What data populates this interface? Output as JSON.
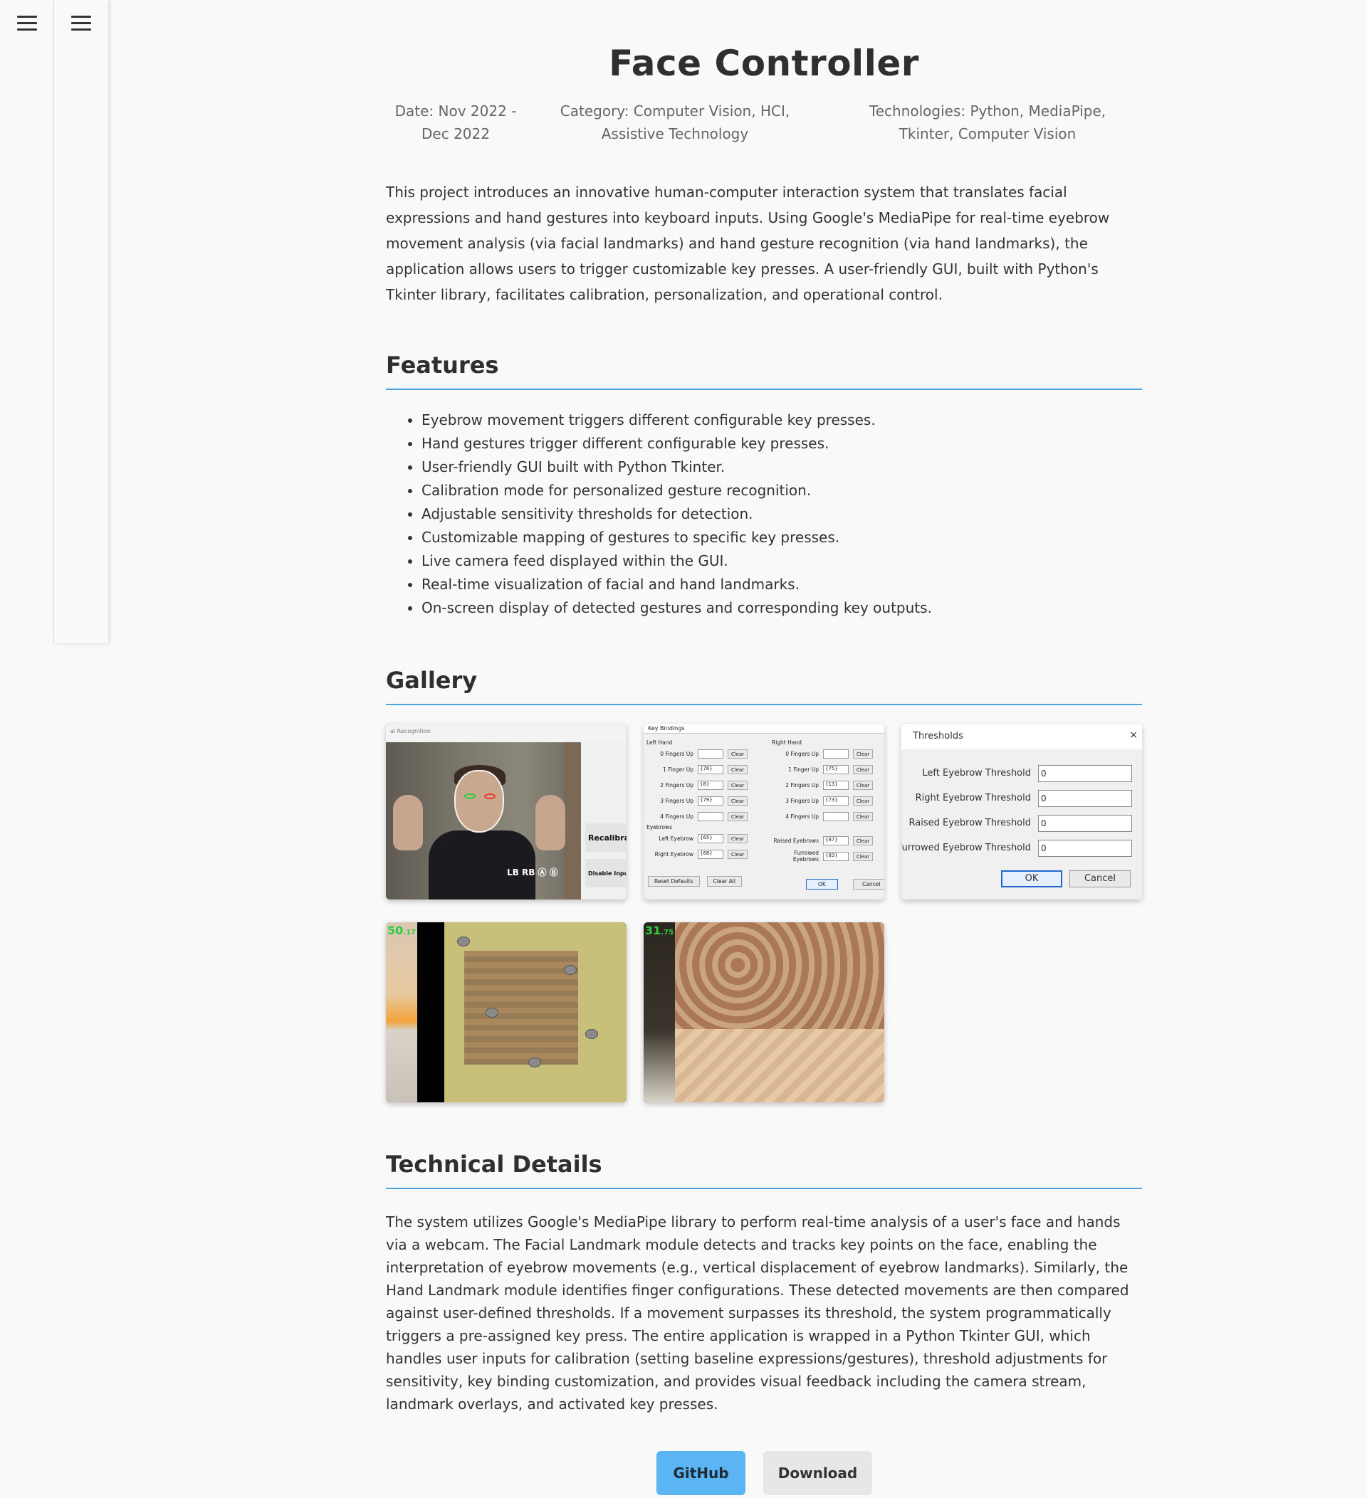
{
  "page": {
    "title": "Face Controller",
    "meta": {
      "date": "Date: Nov 2022 - Dec 2022",
      "category": "Category: Computer Vision, HCI, Assistive Technology",
      "technologies": "Technologies: Python, MediaPipe, Tkinter, Computer Vision"
    },
    "intro": "This project introduces an innovative human-computer interaction system that translates facial expressions and hand gestures into keyboard inputs. Using Google's MediaPipe for real-time eyebrow movement analysis (via facial landmarks) and hand gesture recognition (via hand landmarks), the application allows users to trigger customizable key presses. A user-friendly GUI, built with Python's Tkinter library, facilitates calibration, personalization, and operational control."
  },
  "features": {
    "heading": "Features",
    "items": [
      "Eyebrow movement triggers different configurable key presses.",
      "Hand gestures trigger different configurable key presses.",
      "User-friendly GUI built with Python Tkinter.",
      "Calibration mode for personalized gesture recognition.",
      "Adjustable sensitivity thresholds for detection.",
      "Customizable mapping of gestures to specific key presses.",
      "Live camera feed displayed within the GUI.",
      "Real-time visualization of facial and hand landmarks.",
      "On-screen display of detected gestures and corresponding key outputs."
    ]
  },
  "gallery": {
    "heading": "Gallery",
    "img1": {
      "window_title": "al Recognition",
      "recalibrate": "Recalibra",
      "disable_input": "Disable Inpu",
      "controller": "LB  RB  Ⓐ Ⓑ"
    },
    "img2": {
      "title": "Key Bindings",
      "left_hand": "Left Hand",
      "right_hand": "Right Hand",
      "eyebrows": "Eyebrows",
      "left_rows": [
        {
          "label": "0 Fingers Up",
          "value": ""
        },
        {
          "label": "1 Finger Up",
          "value": "{76}"
        },
        {
          "label": "2 Fingers Up",
          "value": "{8}"
        },
        {
          "label": "3 Fingers Up",
          "value": "{79}"
        },
        {
          "label": "4 Fingers Up",
          "value": ""
        }
      ],
      "right_rows": [
        {
          "label": "0 Fingers Up",
          "value": ""
        },
        {
          "label": "1 Finger Up",
          "value": "{75}"
        },
        {
          "label": "2 Fingers Up",
          "value": "{13}"
        },
        {
          "label": "3 Fingers Up",
          "value": "{73}"
        },
        {
          "label": "4 Fingers Up",
          "value": ""
        }
      ],
      "brow_left": [
        {
          "label": "Left Eyebrow",
          "value": "{65}"
        },
        {
          "label": "Right Eyebrow",
          "value": "{68}"
        }
      ],
      "brow_right": [
        {
          "label": "Raised Eyebrows",
          "value": "{87}"
        },
        {
          "label": "Furrowed Eyebrows",
          "value": "{83}"
        }
      ],
      "clear": "Clear",
      "reset_defaults": "Reset Defaults",
      "clear_all": "Clear All",
      "ok": "OK",
      "cancel": "Cancel"
    },
    "img3": {
      "title": "Thresholds",
      "close": "×",
      "rows": [
        {
          "label": "Left Eyebrow Threshold",
          "value": "0"
        },
        {
          "label": "Right Eyebrow Threshold",
          "value": "0"
        },
        {
          "label": "Raised Eyebrow Threshold",
          "value": "0"
        },
        {
          "label": "Furrowed Eyebrow Threshold",
          "value": "0"
        }
      ],
      "ok": "OK",
      "cancel": "Cancel"
    },
    "img4": {
      "fps": "50",
      "fps_dec": ".17"
    },
    "img5": {
      "fps": "31",
      "fps_dec": ".75"
    }
  },
  "technical": {
    "heading": "Technical Details",
    "body": "The system utilizes Google's MediaPipe library to perform real-time analysis of a user's face and hands via a webcam. The Facial Landmark module detects and tracks key points on the face, enabling the interpretation of eyebrow movements (e.g., vertical displacement of eyebrow landmarks). Similarly, the Hand Landmark module identifies finger configurations. These detected movements are then compared against user-defined thresholds. If a movement surpasses its threshold, the system programmatically triggers a pre-assigned key press. The entire application is wrapped in a Python Tkinter GUI, which handles user inputs for calibration (setting baseline expressions/gestures), threshold adjustments for sensitivity, key binding customization, and provides visual feedback including the camera stream, landmark overlays, and activated key presses."
  },
  "buttons": {
    "github": "GitHub",
    "download": "Download"
  },
  "icons": {
    "menu": "menu-icon"
  },
  "colors": {
    "accent": "#4aa3df",
    "github_button": "#5bb5f5",
    "download_button": "#e7e7e7"
  }
}
